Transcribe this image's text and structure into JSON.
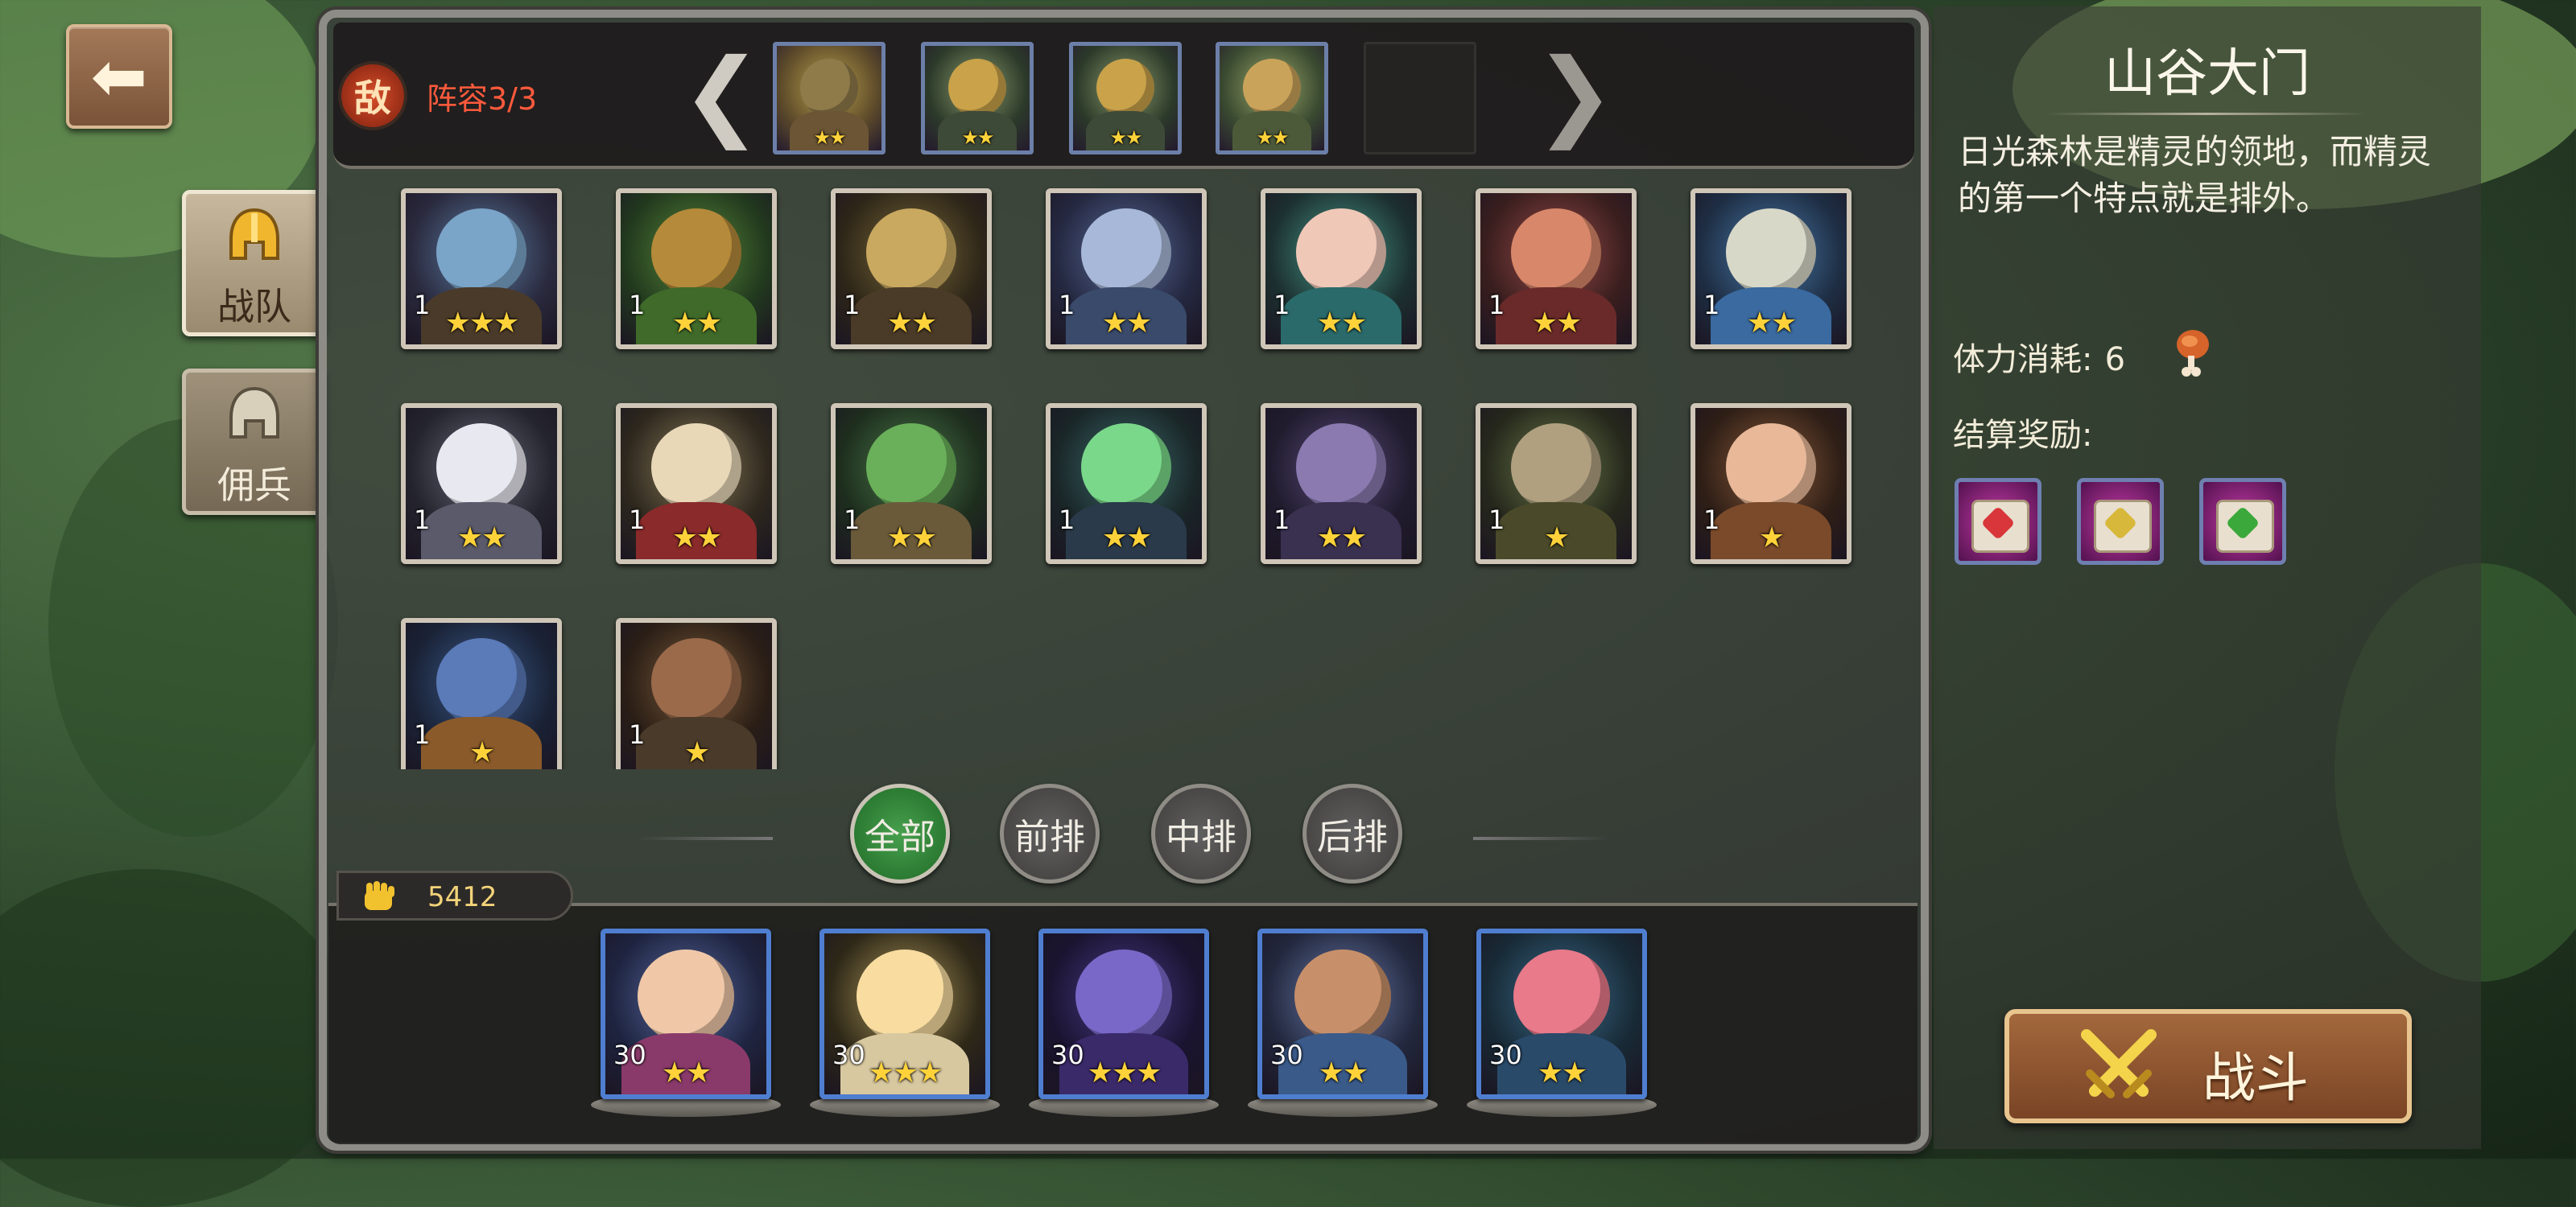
{
  "enemy": {
    "badge": "敌",
    "lineup_label": "阵容3/3",
    "prev_arrow": "❮",
    "next_arrow": "❯",
    "units": [
      {
        "name": "cannon",
        "stars": "★★",
        "colors": [
          "#b9a14a",
          "#5c4a2a",
          "#8f7a4a",
          "#6b5535"
        ]
      },
      {
        "name": "knight",
        "stars": "★★",
        "colors": [
          "#8a9a6a",
          "#2c3a2a",
          "#c9a24a",
          "#3e4a38"
        ]
      },
      {
        "name": "knight",
        "stars": "★★",
        "colors": [
          "#8a9a6a",
          "#2c3a2a",
          "#c9a24a",
          "#3e4a38"
        ]
      },
      {
        "name": "elf-guard",
        "stars": "★★",
        "colors": [
          "#9aa86a",
          "#3a4a30",
          "#caa35a",
          "#4c5a3a"
        ]
      }
    ]
  },
  "roster": [
    {
      "level": "1",
      "stars": "★★★",
      "colors": [
        "#5a7aa0",
        "#2a2a3e",
        "#7aa4c8",
        "#4a3a2a"
      ]
    },
    {
      "level": "1",
      "stars": "★★",
      "colors": [
        "#5a8a3a",
        "#223a1e",
        "#b58a3a",
        "#3f6a2a"
      ]
    },
    {
      "level": "1",
      "stars": "★★",
      "colors": [
        "#7a6a3a",
        "#2e2618",
        "#c9a860",
        "#4a3a28"
      ]
    },
    {
      "level": "1",
      "stars": "★★",
      "colors": [
        "#5a6a9a",
        "#242840",
        "#a8b8d8",
        "#3a4a6a"
      ]
    },
    {
      "level": "1",
      "stars": "★★",
      "colors": [
        "#4a9a8a",
        "#1c3030",
        "#f0c8b8",
        "#2a6a6a"
      ]
    },
    {
      "level": "1",
      "stars": "★★",
      "colors": [
        "#9a4a4a",
        "#3a1e1e",
        "#d8876a",
        "#6a2a2a"
      ]
    },
    {
      "level": "1",
      "stars": "★★",
      "colors": [
        "#4a7aaa",
        "#1e2e44",
        "#d8d8c8",
        "#3a6aa0"
      ]
    },
    {
      "level": "1",
      "stars": "★★",
      "colors": [
        "#6a6a7a",
        "#24242e",
        "#e8e8f0",
        "#5a5a6a"
      ]
    },
    {
      "level": "1",
      "stars": "★★",
      "colors": [
        "#8a7a5a",
        "#2e281e",
        "#e8d8b8",
        "#8a2a2a"
      ]
    },
    {
      "level": "1",
      "stars": "★★",
      "colors": [
        "#4a7a4a",
        "#1e2e1e",
        "#6ab05a",
        "#6a5a3a"
      ]
    },
    {
      "level": "1",
      "stars": "★★",
      "colors": [
        "#3a6a6a",
        "#1a2628",
        "#7ad88a",
        "#2a3a4a"
      ]
    },
    {
      "level": "1",
      "stars": "★★",
      "colors": [
        "#5a4a7a",
        "#201c2e",
        "#8a7ab0",
        "#3a3050"
      ]
    },
    {
      "level": "1",
      "stars": "★",
      "colors": [
        "#6a7a4a",
        "#26281c",
        "#b0a080",
        "#4a4a2a"
      ]
    },
    {
      "level": "1",
      "stars": "★",
      "colors": [
        "#8a5a3a",
        "#2e1e16",
        "#e8b898",
        "#7a4a2a"
      ]
    },
    {
      "level": "1",
      "stars": "★",
      "colors": [
        "#3a5a8a",
        "#1a2236",
        "#5a7ab8",
        "#8a5a2a"
      ]
    },
    {
      "level": "1",
      "stars": "★",
      "colors": [
        "#7a5a3a",
        "#2a1e16",
        "#9a6a4a",
        "#4a3a2a"
      ]
    }
  ],
  "filters": [
    {
      "label": "全部",
      "active": true
    },
    {
      "label": "前排",
      "active": false
    },
    {
      "label": "中排",
      "active": false
    },
    {
      "label": "后排",
      "active": false
    }
  ],
  "power": {
    "value": "5412",
    "icon": "fist-icon"
  },
  "lineup": [
    {
      "level": "30",
      "stars": "★★",
      "colors": [
        "#5a6aa0",
        "#1e2440",
        "#f0c8a8",
        "#8a3a6a"
      ]
    },
    {
      "level": "30",
      "stars": "★★★",
      "colors": [
        "#b09a5a",
        "#2e2818",
        "#f8dca0",
        "#d8c8a0"
      ]
    },
    {
      "level": "30",
      "stars": "★★★",
      "colors": [
        "#4a3a8a",
        "#1a1430",
        "#7a68c8",
        "#3a2a6a"
      ]
    },
    {
      "level": "30",
      "stars": "★★",
      "colors": [
        "#6a7aa8",
        "#22283e",
        "#c8906a",
        "#3a5a8a"
      ]
    },
    {
      "level": "30",
      "stars": "★★",
      "colors": [
        "#3a6a8a",
        "#182a36",
        "#e87a8a",
        "#2a4a6a"
      ]
    }
  ],
  "side_tabs": [
    {
      "label": "战队",
      "icon": "helmet-icon"
    },
    {
      "label": "佣兵",
      "icon": "mercenary-helmet-icon"
    }
  ],
  "back_button": {
    "icon": "back-arrow-icon",
    "glyph": "⬅"
  },
  "stage": {
    "title": "山谷大门",
    "description": "日光森林是精灵的领地，而精灵的第一个特点就是排外。",
    "stamina_label": "体力消耗:",
    "stamina_value": "6",
    "stamina_icon": "meat-drumstick-icon",
    "reward_label": "结算奖励:",
    "rewards": [
      {
        "name": "red-gem-scroll",
        "gem_color": "#d8363a"
      },
      {
        "name": "yellow-gem-scroll",
        "gem_color": "#d8b83a"
      },
      {
        "name": "green-gem-scroll",
        "gem_color": "#3aa83a"
      }
    ]
  },
  "fight_button": {
    "label": "战斗",
    "icon": "crossed-swords-icon"
  }
}
